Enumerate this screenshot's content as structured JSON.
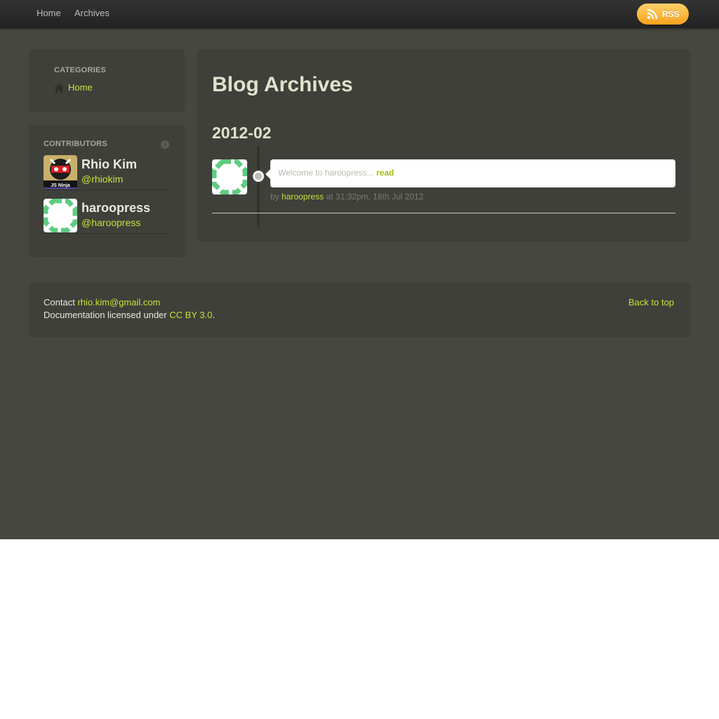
{
  "navbar": {
    "links": [
      "Home",
      "Archives"
    ],
    "rss_label": "RSS",
    "rss_icon": "rss-icon"
  },
  "categories": {
    "header": "Categories",
    "items": [
      {
        "icon": "home-icon",
        "label": "Home"
      }
    ]
  },
  "contributors": {
    "header": "Contributors",
    "info_icon": "info-icon",
    "people": [
      {
        "name": "Rhio Kim",
        "handle": "@rhiokim",
        "avatar_text": "JS Ninja"
      },
      {
        "name": "haroopress",
        "handle": "@haroopress"
      }
    ]
  },
  "main": {
    "title": "Blog Archives",
    "month": "2012-02",
    "posts": [
      {
        "excerpt": "Welcome to haroopress...",
        "read_label": "read",
        "meta_by": "by",
        "author": "haroopress",
        "meta_time": "at 31:32pm, 18th Jul 2012"
      }
    ]
  },
  "footer": {
    "contact_label": "Contact",
    "contact_email": "rhio.kim@gmail.com",
    "license_prefix": "Documentation licensed under",
    "license_link": "CC BY 3.0",
    "license_suffix": ".",
    "back_to_top": "Back to top"
  },
  "colors": {
    "background": "#464740",
    "panel": "#3f403a",
    "accent_link": "#c7e03a",
    "heading": "#dfe3cc",
    "rss_orange": "#f7a21b"
  }
}
